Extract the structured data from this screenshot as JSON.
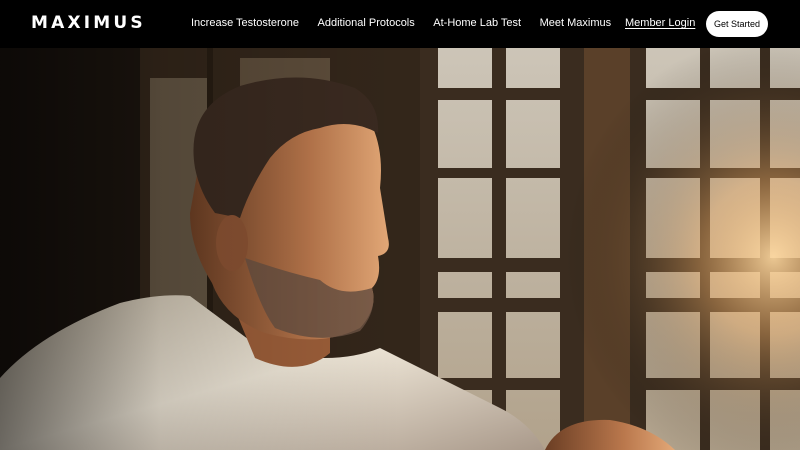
{
  "brand": {
    "logo_text": "MAXIMUS"
  },
  "nav": {
    "links": [
      {
        "label": "Increase Testosterone"
      },
      {
        "label": "Additional Protocols"
      },
      {
        "label": "At-Home Lab Test"
      },
      {
        "label": "Meet Maximus"
      }
    ],
    "member_login": "Member Login",
    "cta": "Get Started"
  },
  "colors": {
    "nav_bg": "#000000",
    "nav_text": "#ffffff",
    "cta_bg": "#ffffff",
    "cta_text": "#000000"
  },
  "hero": {
    "image": "man-by-sunlit-window-photo"
  }
}
